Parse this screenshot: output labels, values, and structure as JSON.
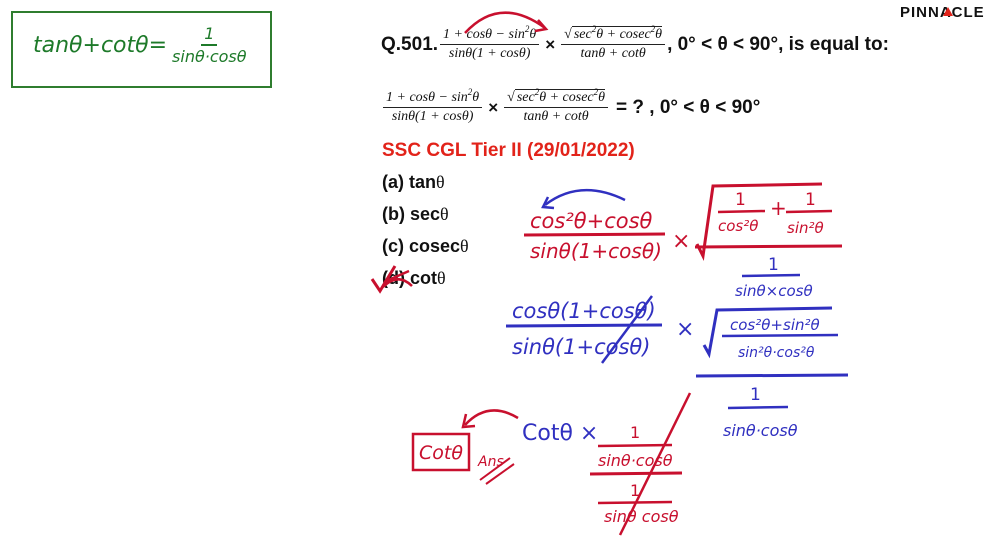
{
  "brand": {
    "name": "PINNACLE"
  },
  "formula_box": {
    "text": "tanθ+cotθ=",
    "num": "1",
    "den": "sinθ·cosθ"
  },
  "question": {
    "number": "Q.501.",
    "f1_num": {
      "a": "1 + cos",
      "b": "θ",
      "c": " − sin",
      "d": "2",
      "e": "θ"
    },
    "f1_den": "sinθ(1 + cosθ)",
    "times": "×",
    "f2_num": {
      "a": "sec",
      "b": "2",
      "c": "θ + cosec",
      "d": "2",
      "e": "θ"
    },
    "f2_den": "tanθ + cotθ",
    "condition": ", 0° < θ < 90°, is equal to:"
  },
  "restatement": {
    "f1_num": {
      "a": "1 + cos",
      "b": "θ",
      "c": " − sin",
      "d": "2",
      "e": "θ"
    },
    "f1_den": "sinθ(1 + cosθ)",
    "f2_num": {
      "a": "sec",
      "b": "2",
      "c": "θ + cosec",
      "d": "2",
      "e": "θ"
    },
    "f2_den": "tanθ + cotθ",
    "tail": "= ? ,  0° < θ < 90°"
  },
  "exam": "SSC CGL Tier II (29/01/2022)",
  "options": [
    {
      "label": "(a) tan",
      "theta": "θ"
    },
    {
      "label": "(b) sec",
      "theta": "θ"
    },
    {
      "label": "(c) cosec",
      "theta": "θ"
    },
    {
      "label": "(d) cot",
      "theta": "θ"
    }
  ],
  "working": {
    "step1_num": "cos²θ+cosθ",
    "step1_den": "sinθ(1+cosθ)",
    "step1_root_a": "1",
    "step1_root_a_den": "cos²θ",
    "step1_root_b": "1",
    "step1_root_b_den": "sin²θ",
    "step1_right_num": "1",
    "step1_right_den": "sinθ×cosθ",
    "step2_num": "cosθ(1+cosθ)",
    "step2_den": "sinθ(1+cosθ)",
    "step2_root_num": "cos²θ+sin²θ",
    "step2_root_den": "sin²θ·cos²θ",
    "step2_right_num": "1",
    "step2_right_den": "sinθ·cosθ",
    "step3_lead": "Cotθ ×",
    "step3_num": "1",
    "step3_mid": "sinθ·cosθ",
    "step3_den_num": "1",
    "step3_den": "sinθ cosθ",
    "answer": "Cotθ",
    "ans_mark": "Ans"
  },
  "colors": {
    "ink_green": "#1e7a2a",
    "ink_blue": "#3030c0",
    "ink_red": "#c8102e",
    "exam_red": "#e2231a",
    "brand_red": "#e2231a"
  }
}
